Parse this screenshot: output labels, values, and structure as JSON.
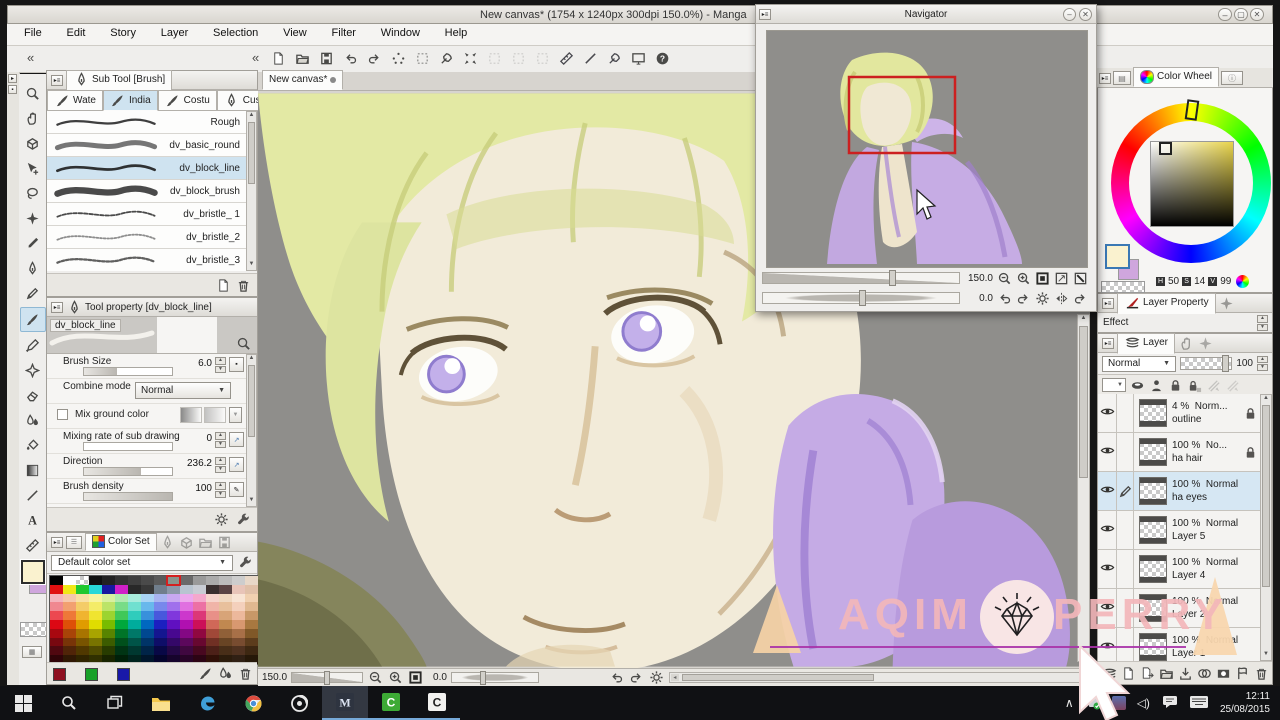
{
  "window": {
    "title": "New canvas* (1754 x 1240px 300dpi 150.0%)  - Manga",
    "controls": [
      "minimize",
      "maximize",
      "close"
    ]
  },
  "menubar": {
    "items": [
      "File",
      "Edit",
      "Story",
      "Layer",
      "Selection",
      "View",
      "Filter",
      "Window",
      "Help"
    ]
  },
  "toolbar": {
    "icons": [
      "new-page",
      "open-file",
      "save",
      "undo",
      "redo",
      "deselect",
      "select-area",
      "pen-select",
      "transform",
      "blend-disabled",
      "tone-disabled",
      "frame-disabled",
      "snap-ruler",
      "snap-angle",
      "snap-special",
      "display-area",
      "help"
    ]
  },
  "tools": {
    "items": [
      "zoom",
      "hand",
      "operate-3d",
      "object",
      "lasso",
      "selection-wand",
      "eyedropper",
      "pen",
      "pencil",
      "brush",
      "marker",
      "decoration",
      "eraser",
      "blend",
      "fill",
      "gradient",
      "figure",
      "text",
      "ruler"
    ],
    "selected": "brush"
  },
  "subtool": {
    "header": "Sub Tool [Brush]",
    "tabs": [
      {
        "label": "Wate"
      },
      {
        "label": "India",
        "selected": true
      },
      {
        "label": "Costu"
      },
      {
        "label": "Custo"
      }
    ],
    "brushes": [
      {
        "name": "Rough"
      },
      {
        "name": "dv_basic_round"
      },
      {
        "name": "dv_block_line",
        "selected": true
      },
      {
        "name": "dv_block_brush"
      },
      {
        "name": "dv_bristle_ 1"
      },
      {
        "name": "dv_bristle_2"
      },
      {
        "name": "dv_bristle_3"
      }
    ]
  },
  "tool_property": {
    "header": "Tool property [dv_block_line]",
    "brush_name": "dv_block_line",
    "brush_size_label": "Brush Size",
    "brush_size": "6.0",
    "combine_label": "Combine mode",
    "combine": "Normal",
    "mix_label": "Mix ground color",
    "mixing_label": "Mixing rate of sub drawing",
    "mixing": "0",
    "direction_label": "Direction",
    "direction": "236.2",
    "density_label": "Brush density",
    "density": "100"
  },
  "color_set": {
    "tab": "Color Set",
    "preset": "Default color set",
    "selected_cell": {
      "row": 0,
      "col": 9
    },
    "footer_swatches": [
      "#8e1020",
      "#18a028",
      "#1818a8"
    ],
    "palette": [
      [
        "#000000",
        "#ffffff",
        "CHK",
        "#111111",
        "#222222",
        "#333333",
        "#3e3e3e",
        "#4a4a4a",
        "#5a5a5a",
        "#8a948c",
        "#6a6a6a",
        "#9a9a9a",
        "#ababab",
        "#bcbcbc",
        "#cdcdcd",
        "#e8d8c8"
      ],
      [
        "#e01010",
        "#f0e818",
        "#20c830",
        "#28d8d8",
        "#1818a0",
        "#d020c8",
        "#282828",
        "#383838",
        "#707e8c",
        "#8c98a8",
        "#b8c4d0",
        "#c8ccd4",
        "#3a3030",
        "#5a4444",
        "#e8c4b8",
        "#e0c0a8"
      ],
      [
        "#f4b4bc",
        "#f6c8ac",
        "#f8e0a4",
        "#f8f4a0",
        "#d8f0a0",
        "#b0eab0",
        "#a8ecdc",
        "#a8d4f4",
        "#a8b4f0",
        "#c8a8f0",
        "#eca8ec",
        "#f4a8cc",
        "#f6d4cc",
        "#f0d8c0",
        "#f8e4d4",
        "#f0d0b0"
      ],
      [
        "#f08890",
        "#f2a070",
        "#f4cc68",
        "#f4ec68",
        "#bce468",
        "#78dc88",
        "#70e0d0",
        "#68b8ec",
        "#7888ec",
        "#a070ec",
        "#e070e0",
        "#ec70a4",
        "#f0b4a8",
        "#e8c09c",
        "#f4d0bc",
        "#e0b890"
      ],
      [
        "#ec4850",
        "#ee7838",
        "#f0b430",
        "#f0e430",
        "#9cd430",
        "#40c858",
        "#30ccbc",
        "#3890dc",
        "#4858dc",
        "#8038dc",
        "#cc38cc",
        "#dc3878",
        "#e89088",
        "#d8a478",
        "#ecb89c",
        "#c89868"
      ],
      [
        "#dc0814",
        "#de5008",
        "#e09c00",
        "#e0dc00",
        "#78bc00",
        "#00a83c",
        "#00ac9c",
        "#0068c0",
        "#1c20c0",
        "#6010c0",
        "#b010b0",
        "#cc1058",
        "#d06858",
        "#c08850",
        "#d89870",
        "#a87840"
      ],
      [
        "#a80810",
        "#a84408",
        "#a87400",
        "#a8a400",
        "#588400",
        "#007428",
        "#007868",
        "#004890",
        "#141690",
        "#480890",
        "#840884",
        "#900840",
        "#a04838",
        "#906038",
        "#a87048",
        "#805828"
      ],
      [
        "#780810",
        "#783408",
        "#785400",
        "#787400",
        "#3c5c00",
        "#00501c",
        "#005448",
        "#003468",
        "#0e0e68",
        "#340868",
        "#5c085c",
        "#680830",
        "#703024",
        "#684424",
        "#784c30",
        "#5c3c1c"
      ],
      [
        "#500810",
        "#502408",
        "#503800",
        "#504c00",
        "#283c00",
        "#003414",
        "#003830",
        "#002448",
        "#080846",
        "#240846",
        "#400840",
        "#480820",
        "#4c2018",
        "#482e18",
        "#503220",
        "#3e2812"
      ],
      [
        "#300408",
        "#301804",
        "#302400",
        "#303000",
        "#182400",
        "#002009",
        "#00241e",
        "#00162c",
        "#04042c",
        "#16042c",
        "#280428",
        "#2c0414",
        "#301008",
        "#2c1c0c",
        "#302014",
        "#261808"
      ]
    ]
  },
  "canvas": {
    "tab": "New canvas*",
    "zoom": "150.0",
    "rotation": "0.0"
  },
  "navigator": {
    "title": "Navigator",
    "zoom": "150.0",
    "rotation": "0.0"
  },
  "color_wheel": {
    "tab": "Color Wheel",
    "h_label": "H",
    "h": "50",
    "s_label": "S",
    "s": "14",
    "v_label": "V",
    "v": "99",
    "foreground": "#faf2cf",
    "background": "#cfa6dd",
    "hue_hex": "#e8d44c"
  },
  "layer_property": {
    "tab": "Layer Property",
    "effect": "Effect"
  },
  "layers": {
    "tab": "Layer",
    "blend": "Normal",
    "opacity": "100",
    "items": [
      {
        "opacity": "4 %",
        "mode": "Norm...",
        "name": "outline",
        "locked": true
      },
      {
        "opacity": "100 %",
        "mode": "No...",
        "name": "ha hair",
        "locked": true
      },
      {
        "opacity": "100 %",
        "mode": "Normal",
        "name": "ha eyes",
        "selected": true
      },
      {
        "opacity": "100 %",
        "mode": "Normal",
        "name": "Layer 5"
      },
      {
        "opacity": "100 %",
        "mode": "Normal",
        "name": "Layer 4"
      },
      {
        "opacity": "100 %",
        "mode": "Normal",
        "name": "Layer 2"
      },
      {
        "opacity": "100 %",
        "mode": "Normal",
        "name": "Layer 1"
      }
    ]
  },
  "taskbar": {
    "apps": [
      "start",
      "search",
      "task-view",
      "file-explorer",
      "edge",
      "chrome",
      "screen-recorder",
      "manga-studio",
      "camtasia-green",
      "camtasia-white"
    ],
    "time": "12:11",
    "date": "25/08/2015"
  },
  "watermark": {
    "left": "AQIM",
    "right": "PERRY"
  }
}
